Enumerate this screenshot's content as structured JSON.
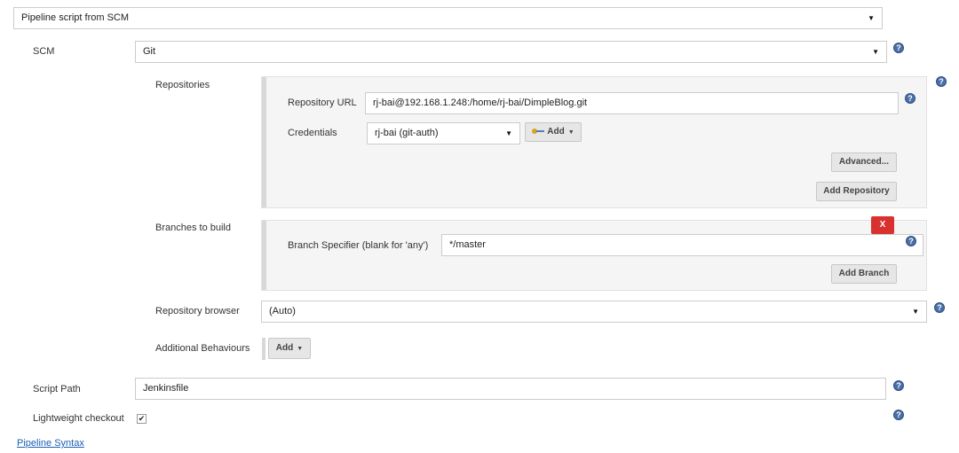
{
  "definition": {
    "selected": "Pipeline script from SCM"
  },
  "scm": {
    "label": "SCM",
    "selected": "Git",
    "repositories": {
      "label": "Repositories",
      "url_label": "Repository URL",
      "url_value": "rj-bai@192.168.1.248:/home/rj-bai/DimpleBlog.git",
      "credentials_label": "Credentials",
      "credentials_selected": "rj-bai (git-auth)",
      "add_label": "Add",
      "advanced_label": "Advanced...",
      "add_repository_label": "Add Repository"
    },
    "branches": {
      "label": "Branches to build",
      "delete_label": "X",
      "specifier_label": "Branch Specifier (blank for 'any')",
      "specifier_value": "*/master",
      "add_branch_label": "Add Branch"
    },
    "repo_browser": {
      "label": "Repository browser",
      "selected": "(Auto)"
    },
    "behaviours": {
      "label": "Additional Behaviours",
      "add_label": "Add"
    }
  },
  "script_path": {
    "label": "Script Path",
    "value": "Jenkinsfile"
  },
  "lightweight": {
    "label": "Lightweight checkout",
    "checked": true
  },
  "pipeline_syntax_link": "Pipeline Syntax",
  "help_glyph": "?"
}
